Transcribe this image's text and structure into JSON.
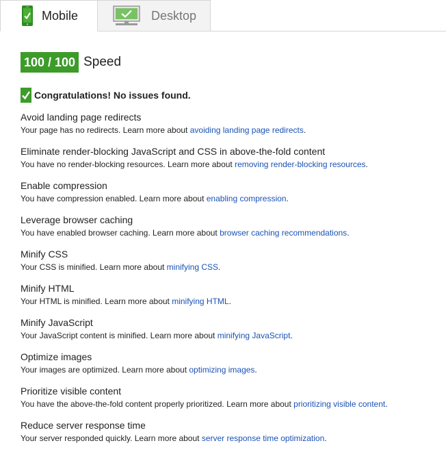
{
  "tabs": [
    {
      "label": "Mobile",
      "icon": "mobile-phone-icon",
      "selected": true
    },
    {
      "label": "Desktop",
      "icon": "desktop-monitor-icon",
      "selected": false
    }
  ],
  "score": {
    "value": "100 / 100",
    "label": "Speed",
    "color": "#3d9b2a"
  },
  "congrats": {
    "icon": "checkmark-icon",
    "text": "Congratulations! No issues found."
  },
  "rules": [
    {
      "title": "Avoid landing page redirects",
      "prefix": "Your page has no redirects. Learn more about ",
      "link": "avoiding landing page redirects",
      "suffix": "."
    },
    {
      "title": "Eliminate render-blocking JavaScript and CSS in above-the-fold content",
      "prefix": "You have no render-blocking resources. Learn more about ",
      "link": "removing render-blocking resources",
      "suffix": "."
    },
    {
      "title": "Enable compression",
      "prefix": "You have compression enabled. Learn more about ",
      "link": "enabling compression",
      "suffix": "."
    },
    {
      "title": "Leverage browser caching",
      "prefix": "You have enabled browser caching. Learn more about ",
      "link": "browser caching recommendations",
      "suffix": "."
    },
    {
      "title": "Minify CSS",
      "prefix": "Your CSS is minified. Learn more about ",
      "link": "minifying CSS",
      "suffix": "."
    },
    {
      "title": "Minify HTML",
      "prefix": "Your HTML is minified. Learn more about ",
      "link": "minifying HTML",
      "suffix": "."
    },
    {
      "title": "Minify JavaScript",
      "prefix": "Your JavaScript content is minified. Learn more about ",
      "link": "minifying JavaScript",
      "suffix": "."
    },
    {
      "title": "Optimize images",
      "prefix": "Your images are optimized. Learn more about ",
      "link": "optimizing images",
      "suffix": "."
    },
    {
      "title": "Prioritize visible content",
      "prefix": "You have the above-the-fold content properly prioritized. Learn more about ",
      "link": "prioritizing visible content",
      "suffix": "."
    },
    {
      "title": "Reduce server response time",
      "prefix": "Your server responded quickly. Learn more about ",
      "link": "server response time optimization",
      "suffix": "."
    }
  ],
  "colors": {
    "accent_green": "#3d9b2a",
    "link_blue": "#1a52b5",
    "tab_border": "#d6d6d6",
    "tab_inactive_bg": "#f3f3f3"
  }
}
